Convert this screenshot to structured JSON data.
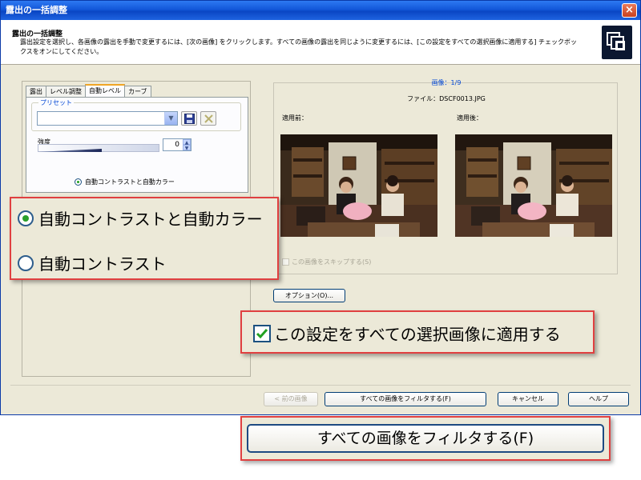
{
  "window": {
    "title": "露出の一括調整",
    "close_label": "×"
  },
  "header": {
    "title": "露出の一括調整",
    "description": "露出設定を選択し、各画像の露出を手動で変更するには、[次の画像] をクリックします。すべての画像の露出を同じように変更するには、[この設定をすべての選択画像に適用する] チェックボックスをオンにしてください。"
  },
  "tabs": [
    {
      "label": "露出"
    },
    {
      "label": "レベル調整"
    },
    {
      "label": "自動レベル"
    },
    {
      "label": "カーブ"
    }
  ],
  "preset": {
    "legend": "プリセット",
    "value": ""
  },
  "strength": {
    "label": "強度",
    "value": "0"
  },
  "small_radio": {
    "label": "自動コントラストと自動カラー"
  },
  "preview": {
    "image_index": "画像：1/9",
    "file_name": "ファイル：DSCF0013.JPG",
    "before_label": "適用前：",
    "after_label": "適用後：",
    "skip_label": "この画像をスキップする(S)"
  },
  "options_button": "オプション(O)...",
  "buttons": {
    "prev": "< 前の画像",
    "filter_all": "すべての画像をフィルタする(F)",
    "cancel": "キャンセル",
    "help": "ヘルプ"
  },
  "callouts": {
    "radio_1": "自動コントラストと自動カラー",
    "radio_2": "自動コントラスト",
    "apply_all": "この設定をすべての選択画像に適用する",
    "filter_all": "すべての画像をフィルタする(F)"
  },
  "colors": {
    "titlebar": "#0a46c4",
    "callout_border": "#e04040",
    "link_blue": "#0046d5"
  },
  "icons": [
    "close-icon",
    "app-logo-icon",
    "save-icon",
    "delete-icon",
    "dropdown-arrow-icon",
    "check-icon"
  ]
}
